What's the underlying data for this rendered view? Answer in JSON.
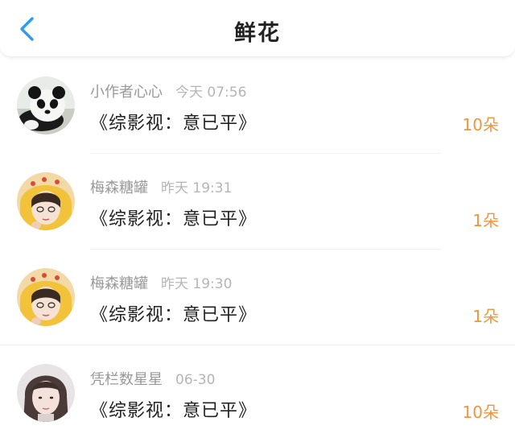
{
  "header": {
    "title": "鲜花",
    "back_icon": "chevron-left-icon",
    "accent_color": "#2f9af2"
  },
  "flowers": {
    "count_color": "#f0953a",
    "items": [
      {
        "user": "小作者心心",
        "time": "今天 07:56",
        "book": "《综影视：意已平》",
        "count": "10朵",
        "avatar": "panda-avatar"
      },
      {
        "user": "梅森糖罐",
        "time": "昨天 19:31",
        "book": "《综影视：意已平》",
        "count": "1朵",
        "avatar": "girl-yellow-hood-avatar"
      },
      {
        "user": "梅森糖罐",
        "time": "昨天 19:30",
        "book": "《综影视：意已平》",
        "count": "1朵",
        "avatar": "girl-yellow-hood-avatar"
      },
      {
        "user": "凭栏数星星",
        "time": "06-30",
        "book": "《综影视：意已平》",
        "count": "10朵",
        "avatar": "girl-portrait-avatar"
      }
    ]
  }
}
